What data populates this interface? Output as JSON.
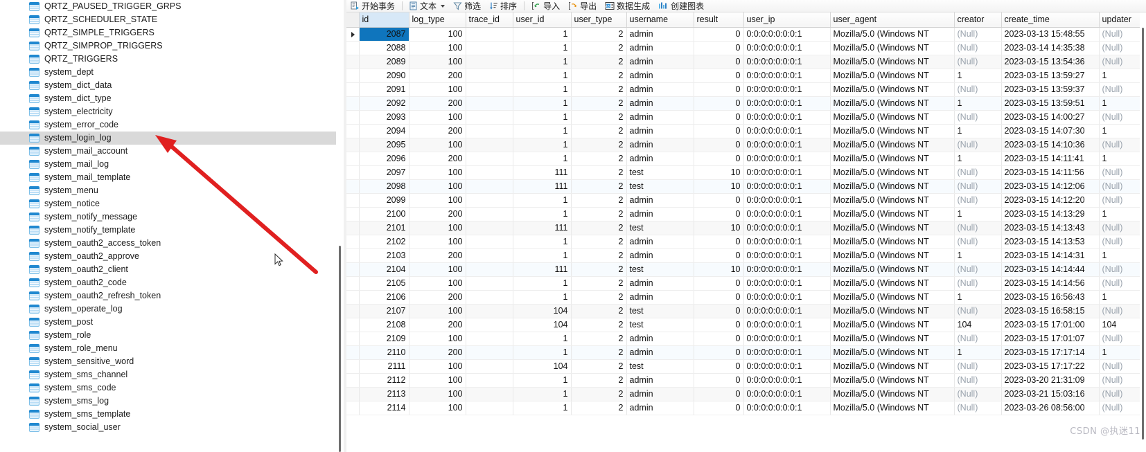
{
  "sidebar": {
    "selected": "system_login_log",
    "items": [
      {
        "label": "QRTZ_PAUSED_TRIGGER_GRPS"
      },
      {
        "label": "QRTZ_SCHEDULER_STATE"
      },
      {
        "label": "QRTZ_SIMPLE_TRIGGERS"
      },
      {
        "label": "QRTZ_SIMPROP_TRIGGERS"
      },
      {
        "label": "QRTZ_TRIGGERS"
      },
      {
        "label": "system_dept"
      },
      {
        "label": "system_dict_data"
      },
      {
        "label": "system_dict_type"
      },
      {
        "label": "system_electricity"
      },
      {
        "label": "system_error_code"
      },
      {
        "label": "system_login_log"
      },
      {
        "label": "system_mail_account"
      },
      {
        "label": "system_mail_log"
      },
      {
        "label": "system_mail_template"
      },
      {
        "label": "system_menu"
      },
      {
        "label": "system_notice"
      },
      {
        "label": "system_notify_message"
      },
      {
        "label": "system_notify_template"
      },
      {
        "label": "system_oauth2_access_token"
      },
      {
        "label": "system_oauth2_approve"
      },
      {
        "label": "system_oauth2_client"
      },
      {
        "label": "system_oauth2_code"
      },
      {
        "label": "system_oauth2_refresh_token"
      },
      {
        "label": "system_operate_log"
      },
      {
        "label": "system_post"
      },
      {
        "label": "system_role"
      },
      {
        "label": "system_role_menu"
      },
      {
        "label": "system_sensitive_word"
      },
      {
        "label": "system_sms_channel"
      },
      {
        "label": "system_sms_code"
      },
      {
        "label": "system_sms_log"
      },
      {
        "label": "system_sms_template"
      },
      {
        "label": "system_social_user"
      }
    ]
  },
  "toolbar": {
    "begin_transaction": "开始事务",
    "text": "文本",
    "filter": "筛选",
    "sort": "排序",
    "import": "导入",
    "export": "导出",
    "data_generation": "数据生成",
    "create_chart": "创建图表"
  },
  "grid": {
    "columns": [
      "id",
      "log_type",
      "trace_id",
      "user_id",
      "user_type",
      "username",
      "result",
      "user_ip",
      "user_agent",
      "creator",
      "create_time",
      "updater"
    ],
    "selected_cell": {
      "row": 0,
      "column": "id"
    },
    "null_text": "(Null)",
    "rows": [
      {
        "id": "2087",
        "log_type": "100",
        "trace_id": "",
        "user_id": "1",
        "user_type": "2",
        "username": "admin",
        "result": "0",
        "user_ip": "0:0:0:0:0:0:0:1",
        "user_agent": "Mozilla/5.0 (Windows NT",
        "creator": "(Null)",
        "create_time": "2023-03-13 15:48:55",
        "updater": "(Null)"
      },
      {
        "id": "2088",
        "log_type": "100",
        "trace_id": "",
        "user_id": "1",
        "user_type": "2",
        "username": "admin",
        "result": "0",
        "user_ip": "0:0:0:0:0:0:0:1",
        "user_agent": "Mozilla/5.0 (Windows NT",
        "creator": "(Null)",
        "create_time": "2023-03-14 14:35:38",
        "updater": "(Null)"
      },
      {
        "id": "2089",
        "log_type": "100",
        "trace_id": "",
        "user_id": "1",
        "user_type": "2",
        "username": "admin",
        "result": "0",
        "user_ip": "0:0:0:0:0:0:0:1",
        "user_agent": "Mozilla/5.0 (Windows NT",
        "creator": "(Null)",
        "create_time": "2023-03-15 13:54:36",
        "updater": "(Null)"
      },
      {
        "id": "2090",
        "log_type": "200",
        "trace_id": "",
        "user_id": "1",
        "user_type": "2",
        "username": "admin",
        "result": "0",
        "user_ip": "0:0:0:0:0:0:0:1",
        "user_agent": "Mozilla/5.0 (Windows NT",
        "creator": "1",
        "create_time": "2023-03-15 13:59:27",
        "updater": "1"
      },
      {
        "id": "2091",
        "log_type": "100",
        "trace_id": "",
        "user_id": "1",
        "user_type": "2",
        "username": "admin",
        "result": "0",
        "user_ip": "0:0:0:0:0:0:0:1",
        "user_agent": "Mozilla/5.0 (Windows NT",
        "creator": "(Null)",
        "create_time": "2023-03-15 13:59:37",
        "updater": "(Null)"
      },
      {
        "id": "2092",
        "log_type": "200",
        "trace_id": "",
        "user_id": "1",
        "user_type": "2",
        "username": "admin",
        "result": "0",
        "user_ip": "0:0:0:0:0:0:0:1",
        "user_agent": "Mozilla/5.0 (Windows NT",
        "creator": "1",
        "create_time": "2023-03-15 13:59:51",
        "updater": "1"
      },
      {
        "id": "2093",
        "log_type": "100",
        "trace_id": "",
        "user_id": "1",
        "user_type": "2",
        "username": "admin",
        "result": "0",
        "user_ip": "0:0:0:0:0:0:0:1",
        "user_agent": "Mozilla/5.0 (Windows NT",
        "creator": "(Null)",
        "create_time": "2023-03-15 14:00:27",
        "updater": "(Null)"
      },
      {
        "id": "2094",
        "log_type": "200",
        "trace_id": "",
        "user_id": "1",
        "user_type": "2",
        "username": "admin",
        "result": "0",
        "user_ip": "0:0:0:0:0:0:0:1",
        "user_agent": "Mozilla/5.0 (Windows NT",
        "creator": "1",
        "create_time": "2023-03-15 14:07:30",
        "updater": "1"
      },
      {
        "id": "2095",
        "log_type": "100",
        "trace_id": "",
        "user_id": "1",
        "user_type": "2",
        "username": "admin",
        "result": "0",
        "user_ip": "0:0:0:0:0:0:0:1",
        "user_agent": "Mozilla/5.0 (Windows NT",
        "creator": "(Null)",
        "create_time": "2023-03-15 14:10:36",
        "updater": "(Null)"
      },
      {
        "id": "2096",
        "log_type": "200",
        "trace_id": "",
        "user_id": "1",
        "user_type": "2",
        "username": "admin",
        "result": "0",
        "user_ip": "0:0:0:0:0:0:0:1",
        "user_agent": "Mozilla/5.0 (Windows NT",
        "creator": "1",
        "create_time": "2023-03-15 14:11:41",
        "updater": "1"
      },
      {
        "id": "2097",
        "log_type": "100",
        "trace_id": "",
        "user_id": "111",
        "user_type": "2",
        "username": "test",
        "result": "10",
        "user_ip": "0:0:0:0:0:0:0:1",
        "user_agent": "Mozilla/5.0 (Windows NT",
        "creator": "(Null)",
        "create_time": "2023-03-15 14:11:56",
        "updater": "(Null)"
      },
      {
        "id": "2098",
        "log_type": "100",
        "trace_id": "",
        "user_id": "111",
        "user_type": "2",
        "username": "test",
        "result": "10",
        "user_ip": "0:0:0:0:0:0:0:1",
        "user_agent": "Mozilla/5.0 (Windows NT",
        "creator": "(Null)",
        "create_time": "2023-03-15 14:12:06",
        "updater": "(Null)"
      },
      {
        "id": "2099",
        "log_type": "100",
        "trace_id": "",
        "user_id": "1",
        "user_type": "2",
        "username": "admin",
        "result": "0",
        "user_ip": "0:0:0:0:0:0:0:1",
        "user_agent": "Mozilla/5.0 (Windows NT",
        "creator": "(Null)",
        "create_time": "2023-03-15 14:12:20",
        "updater": "(Null)"
      },
      {
        "id": "2100",
        "log_type": "200",
        "trace_id": "",
        "user_id": "1",
        "user_type": "2",
        "username": "admin",
        "result": "0",
        "user_ip": "0:0:0:0:0:0:0:1",
        "user_agent": "Mozilla/5.0 (Windows NT",
        "creator": "1",
        "create_time": "2023-03-15 14:13:29",
        "updater": "1"
      },
      {
        "id": "2101",
        "log_type": "100",
        "trace_id": "",
        "user_id": "111",
        "user_type": "2",
        "username": "test",
        "result": "10",
        "user_ip": "0:0:0:0:0:0:0:1",
        "user_agent": "Mozilla/5.0 (Windows NT",
        "creator": "(Null)",
        "create_time": "2023-03-15 14:13:43",
        "updater": "(Null)"
      },
      {
        "id": "2102",
        "log_type": "100",
        "trace_id": "",
        "user_id": "1",
        "user_type": "2",
        "username": "admin",
        "result": "0",
        "user_ip": "0:0:0:0:0:0:0:1",
        "user_agent": "Mozilla/5.0 (Windows NT",
        "creator": "(Null)",
        "create_time": "2023-03-15 14:13:53",
        "updater": "(Null)"
      },
      {
        "id": "2103",
        "log_type": "200",
        "trace_id": "",
        "user_id": "1",
        "user_type": "2",
        "username": "admin",
        "result": "0",
        "user_ip": "0:0:0:0:0:0:0:1",
        "user_agent": "Mozilla/5.0 (Windows NT",
        "creator": "1",
        "create_time": "2023-03-15 14:14:31",
        "updater": "1"
      },
      {
        "id": "2104",
        "log_type": "100",
        "trace_id": "",
        "user_id": "111",
        "user_type": "2",
        "username": "test",
        "result": "10",
        "user_ip": "0:0:0:0:0:0:0:1",
        "user_agent": "Mozilla/5.0 (Windows NT",
        "creator": "(Null)",
        "create_time": "2023-03-15 14:14:44",
        "updater": "(Null)"
      },
      {
        "id": "2105",
        "log_type": "100",
        "trace_id": "",
        "user_id": "1",
        "user_type": "2",
        "username": "admin",
        "result": "0",
        "user_ip": "0:0:0:0:0:0:0:1",
        "user_agent": "Mozilla/5.0 (Windows NT",
        "creator": "(Null)",
        "create_time": "2023-03-15 14:14:56",
        "updater": "(Null)"
      },
      {
        "id": "2106",
        "log_type": "200",
        "trace_id": "",
        "user_id": "1",
        "user_type": "2",
        "username": "admin",
        "result": "0",
        "user_ip": "0:0:0:0:0:0:0:1",
        "user_agent": "Mozilla/5.0 (Windows NT",
        "creator": "1",
        "create_time": "2023-03-15 16:56:43",
        "updater": "1"
      },
      {
        "id": "2107",
        "log_type": "100",
        "trace_id": "",
        "user_id": "104",
        "user_type": "2",
        "username": "test",
        "result": "0",
        "user_ip": "0:0:0:0:0:0:0:1",
        "user_agent": "Mozilla/5.0 (Windows NT",
        "creator": "(Null)",
        "create_time": "2023-03-15 16:58:15",
        "updater": "(Null)"
      },
      {
        "id": "2108",
        "log_type": "200",
        "trace_id": "",
        "user_id": "104",
        "user_type": "2",
        "username": "test",
        "result": "0",
        "user_ip": "0:0:0:0:0:0:0:1",
        "user_agent": "Mozilla/5.0 (Windows NT",
        "creator": "104",
        "create_time": "2023-03-15 17:01:00",
        "updater": "104"
      },
      {
        "id": "2109",
        "log_type": "100",
        "trace_id": "",
        "user_id": "1",
        "user_type": "2",
        "username": "admin",
        "result": "0",
        "user_ip": "0:0:0:0:0:0:0:1",
        "user_agent": "Mozilla/5.0 (Windows NT",
        "creator": "(Null)",
        "create_time": "2023-03-15 17:01:07",
        "updater": "(Null)"
      },
      {
        "id": "2110",
        "log_type": "200",
        "trace_id": "",
        "user_id": "1",
        "user_type": "2",
        "username": "admin",
        "result": "0",
        "user_ip": "0:0:0:0:0:0:0:1",
        "user_agent": "Mozilla/5.0 (Windows NT",
        "creator": "1",
        "create_time": "2023-03-15 17:17:14",
        "updater": "1"
      },
      {
        "id": "2111",
        "log_type": "100",
        "trace_id": "",
        "user_id": "104",
        "user_type": "2",
        "username": "test",
        "result": "0",
        "user_ip": "0:0:0:0:0:0:0:1",
        "user_agent": "Mozilla/5.0 (Windows NT",
        "creator": "(Null)",
        "create_time": "2023-03-15 17:17:22",
        "updater": "(Null)"
      },
      {
        "id": "2112",
        "log_type": "100",
        "trace_id": "",
        "user_id": "1",
        "user_type": "2",
        "username": "admin",
        "result": "0",
        "user_ip": "0:0:0:0:0:0:0:1",
        "user_agent": "Mozilla/5.0 (Windows NT",
        "creator": "(Null)",
        "create_time": "2023-03-20 21:31:09",
        "updater": "(Null)"
      },
      {
        "id": "2113",
        "log_type": "100",
        "trace_id": "",
        "user_id": "1",
        "user_type": "2",
        "username": "admin",
        "result": "0",
        "user_ip": "0:0:0:0:0:0:0:1",
        "user_agent": "Mozilla/5.0 (Windows NT",
        "creator": "(Null)",
        "create_time": "2023-03-21 15:03:16",
        "updater": "(Null)"
      },
      {
        "id": "2114",
        "log_type": "100",
        "trace_id": "",
        "user_id": "1",
        "user_type": "2",
        "username": "admin",
        "result": "0",
        "user_ip": "0:0:0:0:0:0:0:1",
        "user_agent": "Mozilla/5.0 (Windows NT",
        "creator": "(Null)",
        "create_time": "2023-03-26 08:56:00",
        "updater": "(Null)"
      }
    ]
  },
  "watermark": "CSDN @执迷11",
  "colors": {
    "selection_blue": "#0f75bd",
    "sidebar_selected": "#d9d9d9",
    "annotation_red": "#e02020",
    "null_gray": "#9aa3ad"
  }
}
